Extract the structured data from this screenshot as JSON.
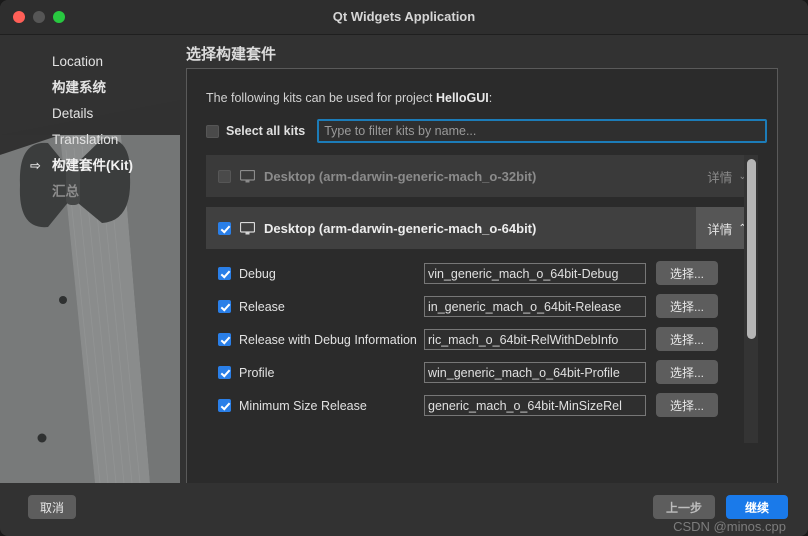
{
  "window": {
    "title": "Qt Widgets Application",
    "traffic_lights": [
      "close-red",
      "minimize-gray",
      "maximize-green"
    ]
  },
  "sidebar": {
    "items": [
      {
        "label": "Location",
        "state": "done",
        "arrow": ""
      },
      {
        "label": "构建系统",
        "state": "done",
        "arrow": ""
      },
      {
        "label": "Details",
        "state": "done",
        "arrow": ""
      },
      {
        "label": "Translation",
        "state": "done",
        "arrow": ""
      },
      {
        "label": "构建套件(Kit)",
        "state": "current",
        "arrow": "⇨"
      },
      {
        "label": "汇总",
        "state": "disabled",
        "arrow": ""
      }
    ]
  },
  "page": {
    "title": "选择构建套件",
    "description_prefix": "The following kits can be used for project ",
    "description_project": "HelloGUI",
    "description_suffix": ":"
  },
  "filter": {
    "select_all_label": "Select all kits",
    "select_all_checked": false,
    "input_value": "",
    "placeholder": "Type to filter kits by name...",
    "focus_color": "#1c7cb8"
  },
  "kits": [
    {
      "name": "Desktop (arm-darwin-generic-mach_o-32bit)",
      "checked": false,
      "enabled": false,
      "expanded": false,
      "details_label": "详情",
      "chevron": "⌄"
    },
    {
      "name": "Desktop (arm-darwin-generic-mach_o-64bit)",
      "checked": true,
      "enabled": true,
      "expanded": true,
      "details_label": "详情",
      "chevron": "⌃"
    }
  ],
  "configurations": [
    {
      "label": "Debug",
      "checked": true,
      "path": "vin_generic_mach_o_64bit-Debug",
      "button": "选择..."
    },
    {
      "label": "Release",
      "checked": true,
      "path": "in_generic_mach_o_64bit-Release",
      "button": "选择..."
    },
    {
      "label": "Release with Debug Information",
      "checked": true,
      "path": "ric_mach_o_64bit-RelWithDebInfo",
      "button": "选择..."
    },
    {
      "label": "Profile",
      "checked": true,
      "path": "win_generic_mach_o_64bit-Profile",
      "button": "选择..."
    },
    {
      "label": "Minimum Size Release",
      "checked": true,
      "path": "generic_mach_o_64bit-MinSizeRel",
      "button": "选择..."
    }
  ],
  "footer": {
    "cancel": "取消",
    "back": "上一步",
    "next": "继续",
    "next_color": "#1a7aea"
  },
  "watermark": "CSDN @minos.cpp"
}
